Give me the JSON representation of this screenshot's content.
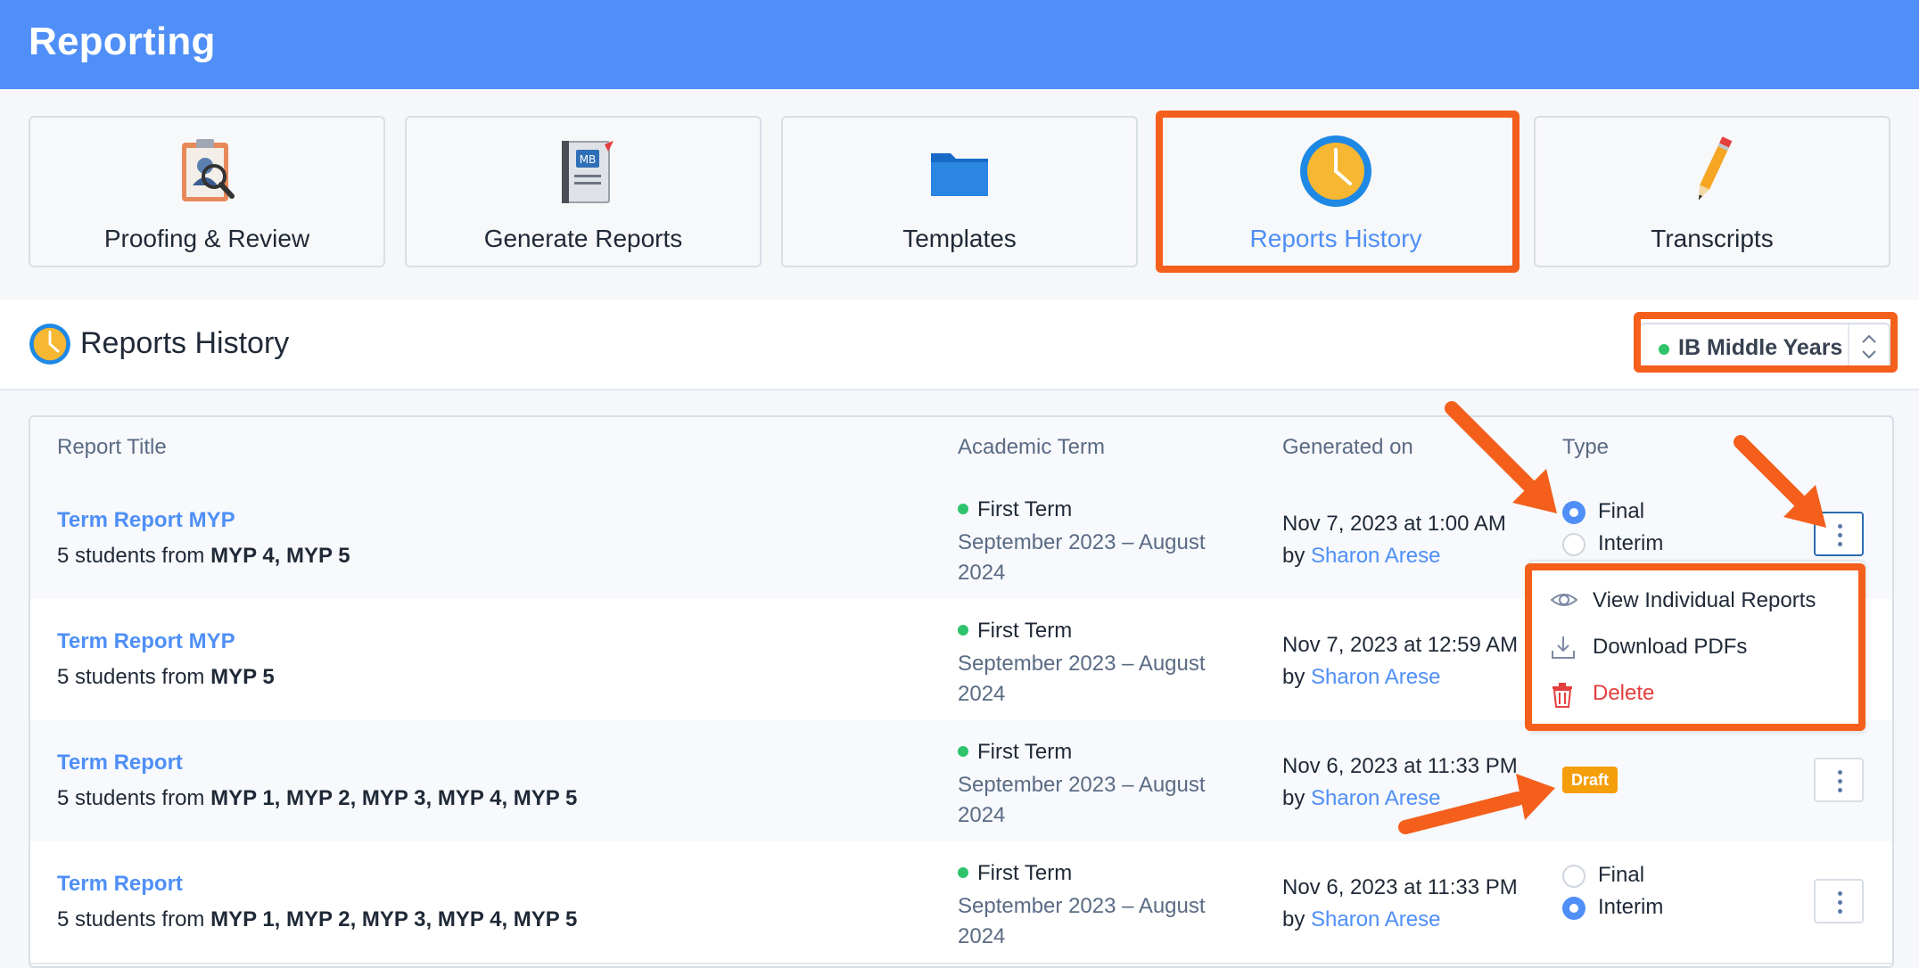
{
  "header": {
    "title": "Reporting"
  },
  "nav": {
    "cards": [
      {
        "label": "Proofing & Review",
        "icon": "clipboard-review-icon"
      },
      {
        "label": "Generate Reports",
        "icon": "report-cards-book-icon"
      },
      {
        "label": "Templates",
        "icon": "folder-icon"
      },
      {
        "label": "Reports History",
        "icon": "clock-icon",
        "active": true
      },
      {
        "label": "Transcripts",
        "icon": "pencil-icon"
      }
    ]
  },
  "section": {
    "title": "Reports History",
    "program_select": {
      "value": "IB Middle Years",
      "status_color": "#2ec46b"
    }
  },
  "table": {
    "columns": [
      "Report Title",
      "Academic Term",
      "Generated on",
      "Type"
    ],
    "rows": [
      {
        "title": "Term Report MYP",
        "students_prefix": "5 students from ",
        "students_groups": "MYP 4, MYP 5",
        "term": "First Term",
        "term_range": "September 2023 – August 2024",
        "generated": "Nov 7, 2023 at 1:00 AM",
        "by_prefix": "by ",
        "by_user": "Sharon Arese",
        "type_final": "Final",
        "type_interim": "Interim",
        "selected": "Final"
      },
      {
        "title": "Term Report MYP",
        "students_prefix": "5 students from ",
        "students_groups": "MYP 5",
        "term": "First Term",
        "term_range": "September 2023 – August 2024",
        "generated": "Nov 7, 2023 at 12:59 AM",
        "by_prefix": "by ",
        "by_user": "Sharon Arese"
      },
      {
        "title": "Term Report",
        "students_prefix": "5 students from ",
        "students_groups": "MYP 1, MYP 2, MYP 3, MYP 4, MYP 5",
        "term": "First Term",
        "term_range": "September 2023 – August 2024",
        "generated": "Nov 6, 2023 at 11:33 PM",
        "by_prefix": "by ",
        "by_user": "Sharon Arese",
        "badge": "Draft"
      },
      {
        "title": "Term Report",
        "students_prefix": "5 students from ",
        "students_groups": "MYP 1, MYP 2, MYP 3, MYP 4, MYP 5",
        "term": "First Term",
        "term_range": "September 2023 – August 2024",
        "generated": "Nov 6, 2023 at 11:33 PM",
        "by_prefix": "by ",
        "by_user": "Sharon Arese",
        "type_final": "Final",
        "type_interim": "Interim",
        "selected": "Interim"
      }
    ]
  },
  "menu": {
    "items": [
      {
        "label": "View Individual Reports",
        "icon": "eye-icon"
      },
      {
        "label": "Download PDFs",
        "icon": "download-icon"
      },
      {
        "label": "Delete",
        "icon": "trash-icon",
        "color": "#e53e3e"
      }
    ]
  },
  "colors": {
    "accent": "#4f8ff7",
    "highlight": "#f45f1c",
    "draft": "#f59e0b"
  }
}
